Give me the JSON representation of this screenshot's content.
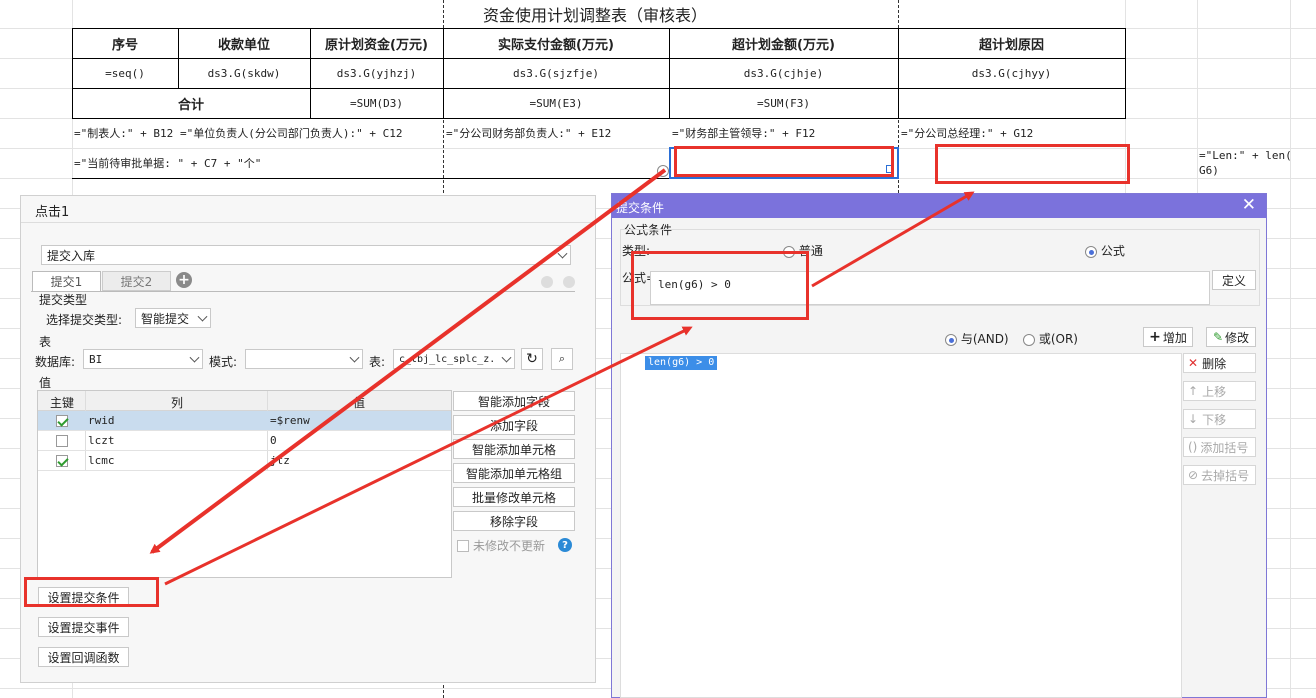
{
  "sheet": {
    "title": "资金使用计划调整表（审核表）",
    "headers": [
      "序号",
      "收款单位",
      "原计划资金(万元)",
      "实际支付金额(万元)",
      "超计划金额(万元)",
      "超计划原因"
    ],
    "data_row": [
      "=seq()",
      "ds3.G(skdw)",
      "ds3.G(yjhzj)",
      "ds3.G(sjzfje)",
      "ds3.G(cjhje)",
      "ds3.G(cjhyy)"
    ],
    "total_label": "合计",
    "totals": [
      "=SUM(D3)",
      "=SUM(E3)",
      "=SUM(F3)"
    ],
    "sign_row": [
      "=\"制表人:\" + B12",
      "=\"单位负责人(分公司部门负责人):\" + C12",
      "=\"分公司财务部负责人:\" + E12",
      "=\"财务部主管领导:\" + F12",
      "=\"分公司总经理:\" + G12"
    ],
    "pending_formula": "=\"当前待审批单据: \" + C7 + \"个\"",
    "len_formula_line1": "=\"Len:\" + len(",
    "len_formula_line2": "G6)"
  },
  "panel": {
    "title": "点击1",
    "action_select": "提交入库",
    "tabs": [
      "提交1",
      "提交2"
    ],
    "add_tab_icon": "plus-circle-icon",
    "submit_type_section": "提交类型",
    "submit_type_label": "选择提交类型:",
    "submit_type_value": "智能提交",
    "table_section": "表",
    "db_label": "数据库:",
    "db_value": "BI",
    "mode_label": "模式:",
    "mode_value": "",
    "table_label": "表:",
    "table_value": "c_tbj_lc_splc_z.",
    "value_section": "值",
    "grid_headers": [
      "主键",
      "列",
      "值"
    ],
    "grid_rows": [
      {
        "key": true,
        "col": "rwid",
        "val": "=$renw"
      },
      {
        "key": false,
        "col": "lczt",
        "val": "0"
      },
      {
        "key": true,
        "col": "lcmc",
        "val": "jtz"
      }
    ],
    "right_buttons": [
      "智能添加字段",
      "添加字段",
      "智能添加单元格",
      "智能添加单元格组",
      "批量修改单元格",
      "移除字段"
    ],
    "no_update_label": "未修改不更新",
    "bottom_buttons": [
      "设置提交条件",
      "设置提交事件",
      "设置回调函数"
    ]
  },
  "dialog": {
    "title": "提交条件",
    "section": "公式条件",
    "type_label": "类型:",
    "type_options": [
      "普通",
      "公式"
    ],
    "type_selected": "公式",
    "formula_label": "公式=",
    "formula_value": "len(g6) > 0",
    "define_button": "定义",
    "logic_options": [
      "与(AND)",
      "或(OR)"
    ],
    "logic_selected": "与(AND)",
    "add_button": "增加",
    "modify_button": "修改",
    "condition_items": [
      "len(g6) > 0"
    ],
    "side_buttons": [
      "删除",
      "上移",
      "下移",
      "添加括号",
      "去掉括号"
    ]
  },
  "colors": {
    "accent_purple": "#7b72dc",
    "annotation_red": "#e8322b",
    "selection_blue": "#2b6fd6",
    "condition_highlight": "#3c8ee8"
  }
}
